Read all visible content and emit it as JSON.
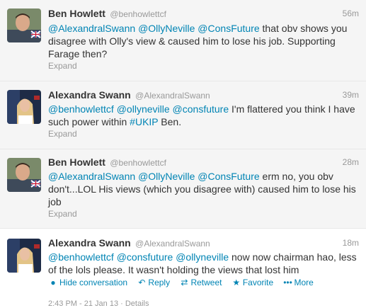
{
  "tweets": [
    {
      "fullname": "Ben Howlett",
      "screenname": "@benhowlettcf",
      "time": "56m",
      "mentions": [
        "@AlexandralSwann",
        "@OllyNeville",
        "@ConsFuture"
      ],
      "text": " that obv shows you disagree with Olly's view & caused him to lose his job. Supporting Farage then?",
      "expand": "Expand"
    },
    {
      "fullname": "Alexandra Swann",
      "screenname": "@AlexandralSwann",
      "time": "39m",
      "mentions": [
        "@benhowlettcf",
        "@ollyneville",
        "@consfuture"
      ],
      "text_before": " I'm flattered you think I have such power within ",
      "hashtag": "#UKIP",
      "text_after": " Ben.",
      "expand": "Expand"
    },
    {
      "fullname": "Ben Howlett",
      "screenname": "@benhowlettcf",
      "time": "28m",
      "mentions": [
        "@AlexandralSwann",
        "@OllyNeville",
        "@ConsFuture"
      ],
      "text": " erm no, you obv don't...LOL His views (which you disagree with) caused him to lose his job",
      "expand": "Expand"
    },
    {
      "fullname": "Alexandra Swann",
      "screenname": "@AlexandralSwann",
      "time": "18m",
      "mentions": [
        "@benhowlettcf",
        "@consfuture",
        "@ollyneville"
      ],
      "text": " now now chairman hao, less of the lols please. It wasn't holding the views that lost him",
      "actions": {
        "hide": "Hide conversation",
        "reply": "Reply",
        "retweet": "Retweet",
        "favorite": "Favorite",
        "more": "More"
      },
      "meta": "2:43 PM - 21 Jan 13 · Details"
    }
  ],
  "icons": {
    "hide": "speech-bubble-icon",
    "reply": "reply-arrow-icon",
    "retweet": "retweet-icon",
    "favorite": "star-icon",
    "more": "ellipsis-icon"
  },
  "colors": {
    "link": "#0084b4",
    "muted": "#999999",
    "text": "#333333",
    "expanded_bg": "#f5f5f5"
  }
}
